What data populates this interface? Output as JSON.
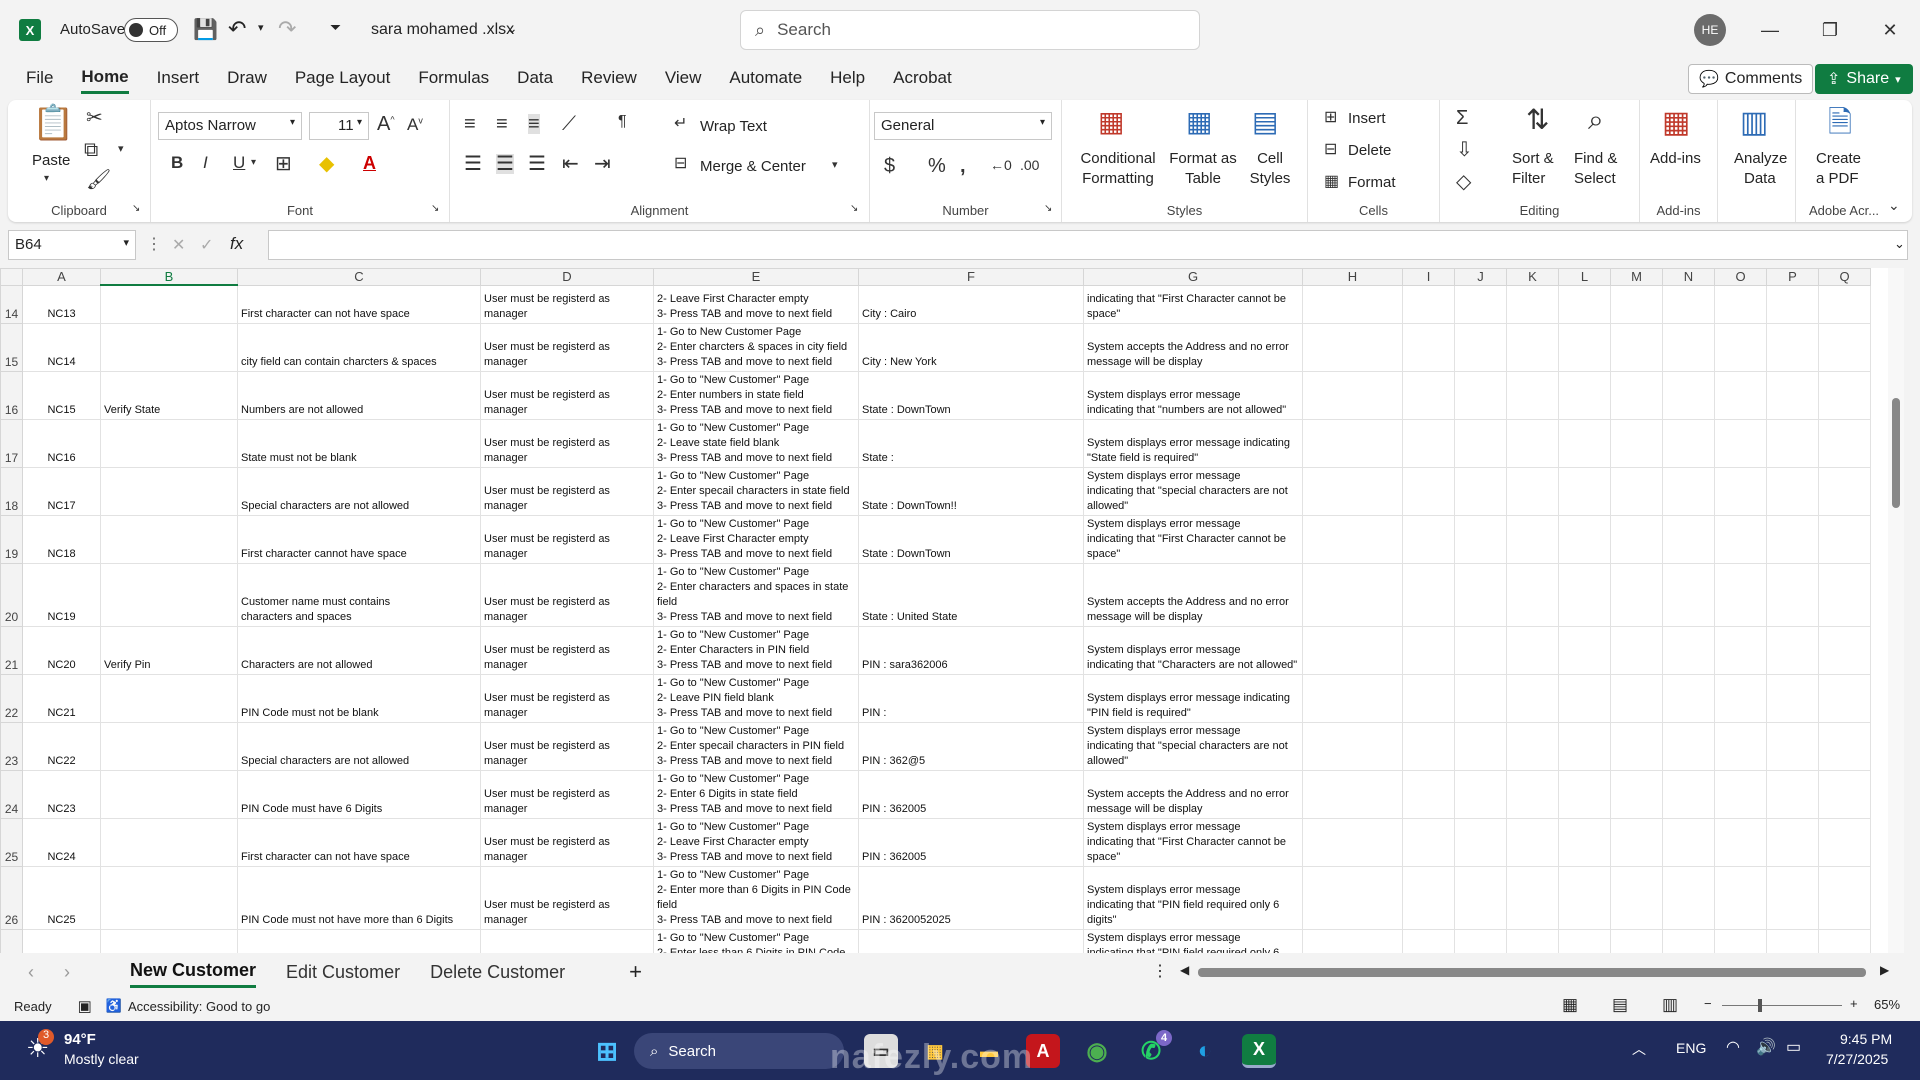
{
  "titlebar": {
    "autosave_label": "AutoSave",
    "toggle_state": "Off",
    "filename": "sara mohamed .xlsx",
    "search_placeholder": "Search",
    "avatar_initials": "HE"
  },
  "menu": {
    "tabs": [
      "File",
      "Home",
      "Insert",
      "Draw",
      "Page Layout",
      "Formulas",
      "Data",
      "Review",
      "View",
      "Automate",
      "Help",
      "Acrobat"
    ],
    "active": "Home",
    "comments_label": "Comments",
    "share_label": "Share"
  },
  "ribbon": {
    "clipboard": {
      "paste": "Paste",
      "label": "Clipboard"
    },
    "font": {
      "name": "Aptos Narrow",
      "size": "11",
      "label": "Font"
    },
    "alignment": {
      "wrap": "Wrap Text",
      "merge": "Merge & Center",
      "label": "Alignment"
    },
    "number": {
      "format": "General",
      "label": "Number"
    },
    "styles": {
      "conditional_1": "Conditional",
      "conditional_2": "Formatting",
      "format_table_1": "Format as",
      "format_table_2": "Table",
      "cell_styles_1": "Cell",
      "cell_styles_2": "Styles",
      "label": "Styles"
    },
    "cells": {
      "insert": "Insert",
      "delete": "Delete",
      "format": "Format",
      "label": "Cells"
    },
    "editing": {
      "sort_1": "Sort &",
      "sort_2": "Filter",
      "find_1": "Find &",
      "find_2": "Select",
      "label": "Editing"
    },
    "addins": {
      "button": "Add-ins",
      "label": "Add-ins"
    },
    "analyze": {
      "line1": "Analyze",
      "line2": "Data"
    },
    "acrobat": {
      "line1": "Create",
      "line2": "a PDF",
      "label": "Adobe Acr..."
    }
  },
  "formula_bar": {
    "name_box": "B64",
    "fx": "fx",
    "content": ""
  },
  "columns": [
    "A",
    "B",
    "C",
    "D",
    "E",
    "F",
    "G",
    "H",
    "I",
    "J",
    "K",
    "L",
    "M",
    "N",
    "O",
    "P",
    "Q"
  ],
  "rows": [
    {
      "num": "14",
      "a": "NC13",
      "b": "",
      "c": "First character can not have space",
      "d": "User must be registerd as manager",
      "e": "2- Leave First Character empty\n3- Press TAB and move to next field",
      "f": "City :    Cairo",
      "g": "indicating that \"First Character cannot be\nspace\""
    },
    {
      "num": "15",
      "a": "NC14",
      "b": "",
      "c": "city field can contain charcters & spaces",
      "d": "User must be registerd as manager",
      "e": "1- Go to New Customer Page\n2- Enter charcters & spaces in city field\n3- Press TAB and move to next field",
      "f": "City :   New York",
      "g": "System accepts the Address and no error\nmessage will be display"
    },
    {
      "num": "16",
      "a": "NC15",
      "b": "Verify State",
      "c": "Numbers are not allowed",
      "d": "User must be registerd as manager",
      "e": "1- Go to \"New Customer\" Page\n2- Enter numbers in state field\n3- Press TAB and move to next field",
      "f": "State : DownTown",
      "g": "System displays error message\nindicating that \"numbers are not allowed\""
    },
    {
      "num": "17",
      "a": "NC16",
      "b": "",
      "c": "State must not be blank",
      "d": "User must be registerd as manager",
      "e": "1- Go to \"New Customer\" Page\n2- Leave state field blank\n3- Press TAB and move to next field",
      "f": "State :",
      "g": "System displays error message indicating\n\"State field is required\""
    },
    {
      "num": "18",
      "a": "NC17",
      "b": "",
      "c": "Special characters are not allowed",
      "d": "User must be registerd as manager",
      "e": "1- Go to \"New Customer\" Page\n2- Enter specail characters in state field\n3- Press TAB and move to next field",
      "f": "State : DownTown!!",
      "g": "System displays error message\nindicating that \"special characters are not\nallowed\""
    },
    {
      "num": "19",
      "a": "NC18",
      "b": "",
      "c": "First character cannot have space",
      "d": "User must be registerd as manager",
      "e": "1- Go to \"New Customer\" Page\n2- Leave First Character empty\n3- Press TAB and move to next field",
      "f": "State :    DownTown",
      "g": "System displays error message\nindicating that \"First Character cannot be\nspace\""
    },
    {
      "num": "20",
      "a": "NC19",
      "b": "",
      "c": "Customer name must contains\ncharacters and spaces",
      "d": "User must be registerd as manager",
      "e": "1- Go to \"New Customer\" Page\n2- Enter characters and spaces in state\nfield\n3- Press TAB and move to next field",
      "f": "State : United State",
      "g": "System accepts the Address and no error\nmessage will be display"
    },
    {
      "num": "21",
      "a": "NC20",
      "b": "Verify Pin",
      "c": "Characters are not allowed",
      "d": "User must be registerd as manager",
      "e": "1- Go to \"New Customer\" Page\n2- Enter Characters in PIN field\n3- Press TAB and move to next field",
      "f": "PIN : sara362006",
      "g": "System displays error message\nindicating that \"Characters are not allowed\""
    },
    {
      "num": "22",
      "a": "NC21",
      "b": "",
      "c": "PIN Code must not be blank",
      "d": "User must be registerd as manager",
      "e": "1- Go to \"New Customer\" Page\n2- Leave PIN field blank\n3- Press TAB and move to next field",
      "f": "PIN :",
      "g": "System displays error message indicating\n\"PIN field is required\""
    },
    {
      "num": "23",
      "a": "NC22",
      "b": "",
      "c": "Special characters are not allowed",
      "d": "User must be registerd as manager",
      "e": "1- Go to \"New Customer\" Page\n2- Enter specail characters in PIN field\n3- Press TAB and move to next field",
      "f": "PIN : 362@5",
      "g": "System displays error message\nindicating that \"special characters are not\nallowed\""
    },
    {
      "num": "24",
      "a": "NC23",
      "b": "",
      "c": "PIN Code must have 6 Digits",
      "d": "User must be registerd as manager",
      "e": "1- Go to \"New Customer\" Page\n2- Enter  6 Digits in state field\n3- Press TAB and move to next field",
      "f": "PIN : 362005",
      "g": "System accepts the Address and no error\nmessage will be display"
    },
    {
      "num": "25",
      "a": "NC24",
      "b": "",
      "c": "First character can not have space",
      "d": "User must be registerd as manager",
      "e": "1- Go to \"New Customer\" Page\n2- Leave First Character empty\n3- Press TAB and move to next field",
      "f": "PIN :    362005",
      "g": "System displays error message\nindicating that \"First Character cannot be\nspace\""
    },
    {
      "num": "26",
      "a": "NC25",
      "b": "",
      "c": "PIN Code must not have more than 6 Digits",
      "d": "User must be registerd as manager",
      "e": "1- Go to \"New Customer\" Page\n2- Enter more than 6 Digits in PIN Code\nfield\n3- Press TAB and move to next field",
      "f": "PIN : 3620052025",
      "g": "System displays error message\nindicating that \"PIN field required only 6\ndigits\""
    },
    {
      "num": "27",
      "a": "",
      "b": "",
      "c": "",
      "d": "",
      "e": "1- Go to \"New Customer\" Page\n2- Enter  less than 6 Digits in PIN Code",
      "f": "",
      "g": "System displays error message\nindicating that \"PIN field required only 6"
    }
  ],
  "sheet_tabs": [
    "New Customer",
    "Edit Customer",
    "Delete Customer"
  ],
  "active_sheet": "New Customer",
  "status": {
    "ready": "Ready",
    "accessibility": "Accessibility: Good to go",
    "zoom": "65%"
  },
  "taskbar": {
    "temp": "94°F",
    "weather": "Mostly clear",
    "weather_badge": "3",
    "search": "Search",
    "lang": "ENG",
    "time": "9:45 PM",
    "date": "7/27/2025",
    "whatsapp_badge": "4"
  },
  "watermark": "nafezly.com",
  "colors": {
    "excel_green": "#107c41",
    "taskbar": "#1f2b5c"
  }
}
